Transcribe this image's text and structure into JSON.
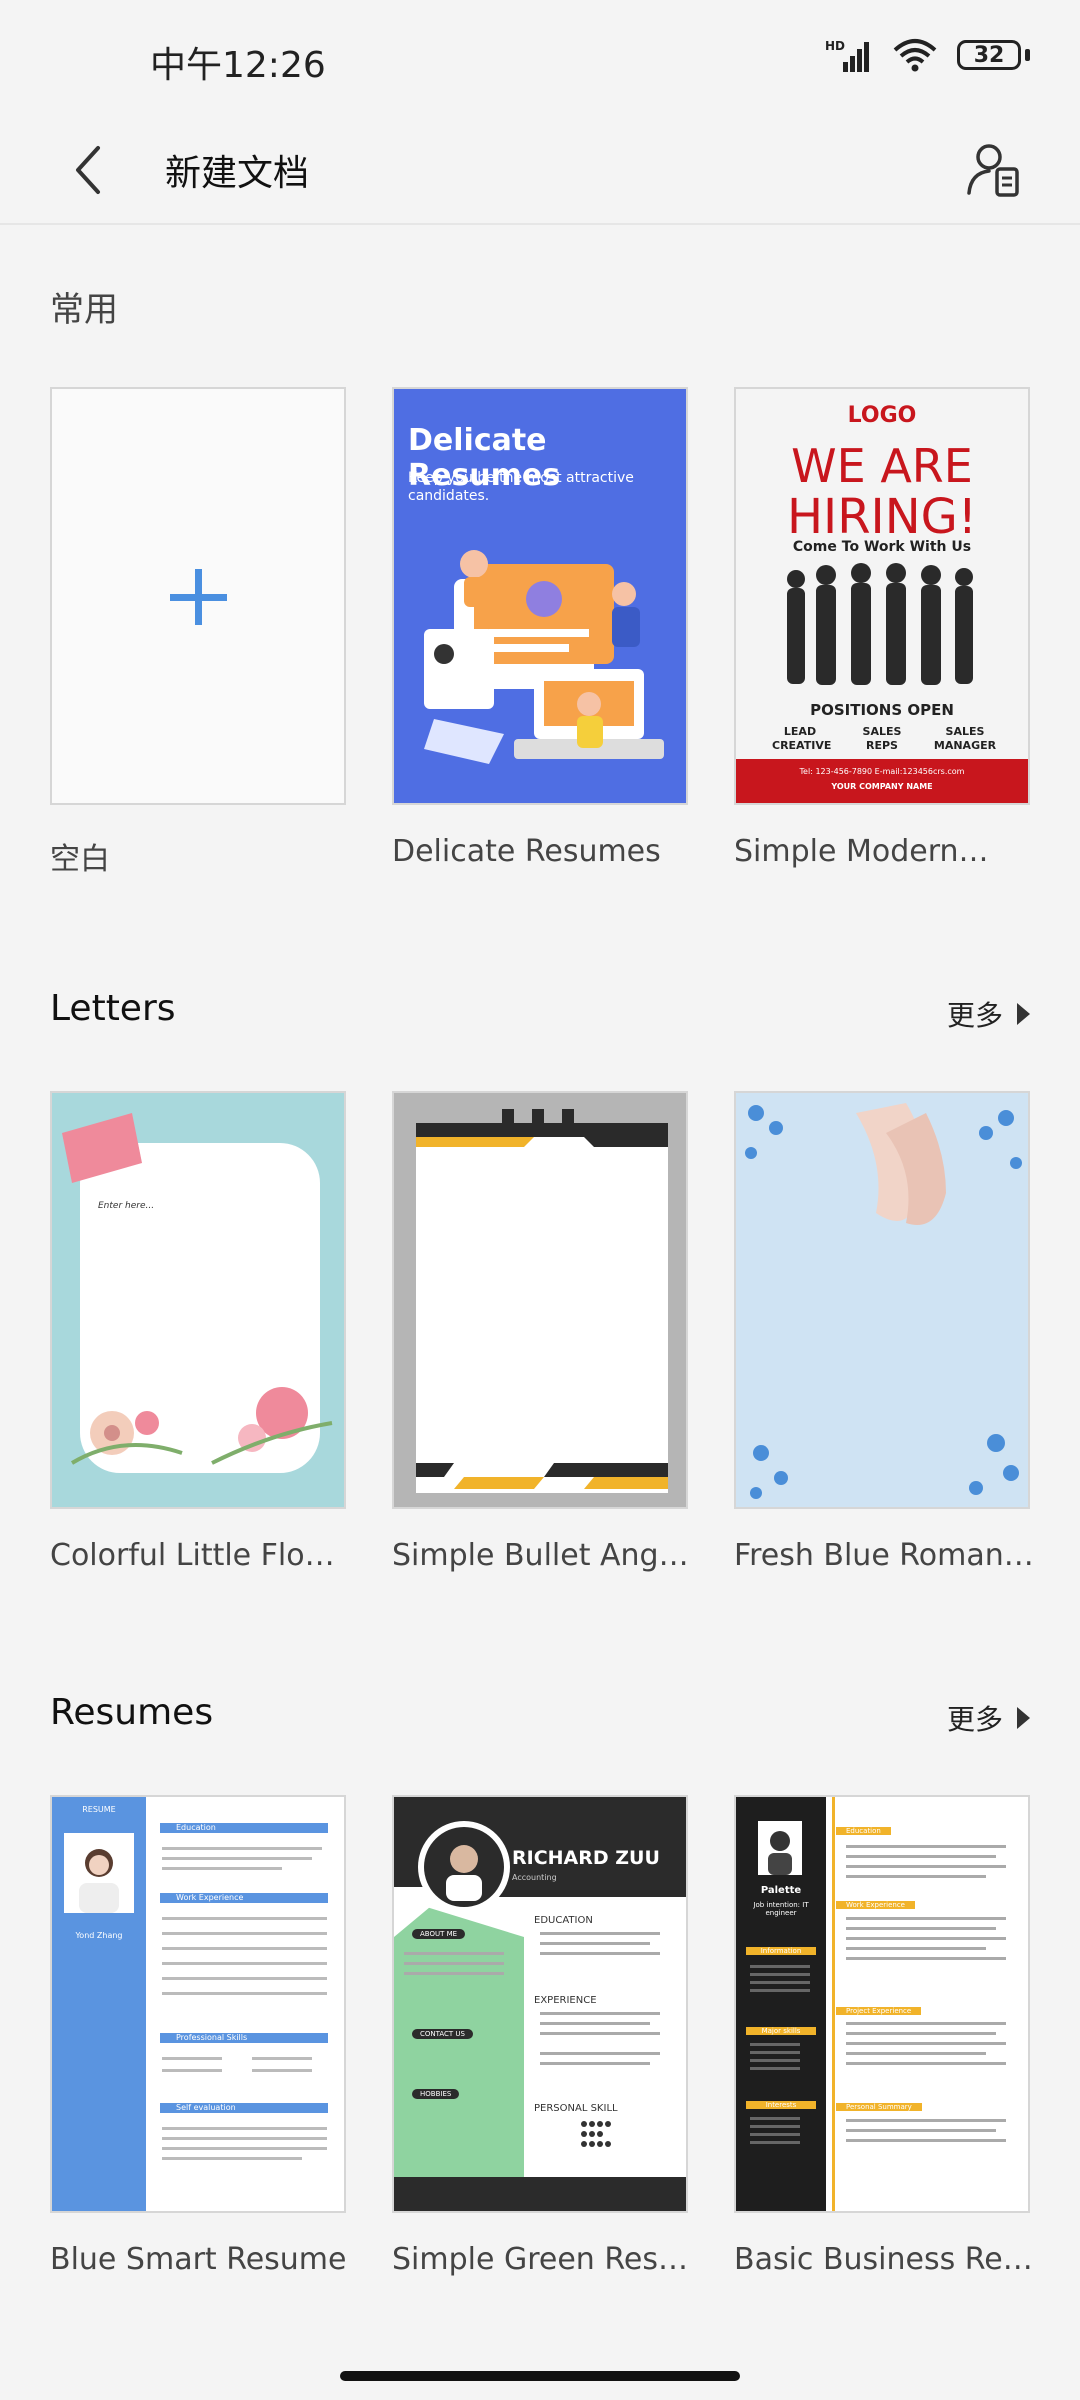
{
  "status": {
    "time": "中午12:26",
    "network": "HD",
    "battery": "32"
  },
  "header": {
    "title": "新建文档"
  },
  "sections": [
    {
      "title": "常用",
      "items": [
        {
          "label": "空白"
        },
        {
          "label": "Delicate Resumes",
          "preview": {
            "heading": "Delicate Resumes",
            "sub": "Keep you be the most attractive candidates."
          }
        },
        {
          "label": "Simple Modern…",
          "preview": {
            "logo": "LOGO",
            "headline1": "WE ARE",
            "headline2": "HIRING!",
            "sub": "Come To Work With Us",
            "positions": "POSITIONS OPEN",
            "roles": [
              "LEAD CREATIVE",
              "SALES REPS",
              "SALES MANAGER"
            ],
            "contact": "Tel: 123-456-7890    E-mail:123456crs.com",
            "company": "YOUR COMPANY NAME"
          }
        }
      ]
    },
    {
      "title": "Letters",
      "more": "更多",
      "items": [
        {
          "label": "Colorful Little Flowe…",
          "preview": {
            "text": "Enter here..."
          }
        },
        {
          "label": "Simple Bullet Angel…"
        },
        {
          "label": "Fresh Blue Romantic…"
        }
      ]
    },
    {
      "title": "Resumes",
      "more": "更多",
      "items": [
        {
          "label": "Blue Smart Resume",
          "preview": {
            "tag": "RESUME",
            "name": "Yond Zhang",
            "sections": [
              "Education",
              "Work Experience",
              "Professional Skills",
              "Self evaluation"
            ]
          }
        },
        {
          "label": "Simple Green Resume",
          "preview": {
            "name": "RICHARD ZUU",
            "role": "Accounting",
            "sections": [
              "EDUCATION",
              "EXPERIENCE",
              "PERSONAL SKILL"
            ],
            "left": [
              "ABOUT ME",
              "CONTACT US",
              "HOBBIES"
            ]
          }
        },
        {
          "label": "Basic Business Resume",
          "preview": {
            "name": "Palette",
            "role": "Job intention: IT engineer",
            "sections": [
              "Education",
              "Work Experience",
              "Project Experience",
              "Personal Summary"
            ],
            "left": [
              "Information",
              "Major skills",
              "Interests"
            ]
          }
        }
      ]
    }
  ],
  "colors": {
    "accent": "#4a8fe0",
    "brandRed": "#c8161d",
    "green": "#8fd3a0",
    "blue": "#4a8ed8"
  }
}
